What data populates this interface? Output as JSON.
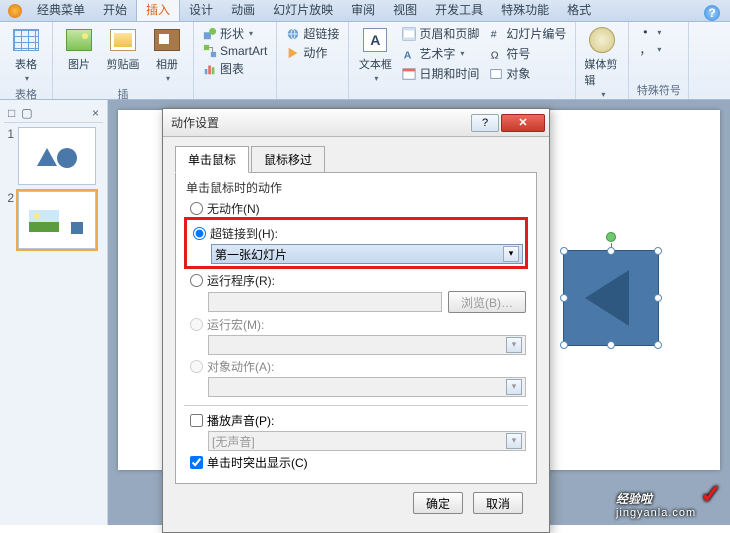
{
  "tabs": {
    "classic": "经典菜单",
    "home": "开始",
    "insert": "插入",
    "design": "设计",
    "anim": "动画",
    "slideshow": "幻灯片放映",
    "review": "审阅",
    "view": "视图",
    "dev": "开发工具",
    "special": "特殊功能",
    "format": "格式"
  },
  "ribbon": {
    "table": "表格",
    "picture": "图片",
    "clipart": "剪贴画",
    "album": "相册",
    "shapes": "形状",
    "smartart": "SmartArt",
    "chart": "图表",
    "hyperlink": "超链接",
    "action": "动作",
    "textbox": "文本框",
    "headerfooter": "页眉和页脚",
    "wordart": "艺术字",
    "datetime": "日期和时间",
    "slidenum": "幻灯片编号",
    "symbol": "符号",
    "object": "对象",
    "media": "媒体剪辑",
    "group_table": "表格",
    "group_illus": "插",
    "group_special": "特殊符号"
  },
  "sidepanel": {
    "tab1": "□",
    "tab2": "▢",
    "close": "×",
    "slide1": "1",
    "slide2": "2"
  },
  "dialog": {
    "title": "动作设置",
    "help": "?",
    "close": "✕",
    "tab_click": "单击鼠标",
    "tab_hover": "鼠标移过",
    "section": "单击鼠标时的动作",
    "opt_none": "无动作(N)",
    "opt_hyperlink": "超链接到(H):",
    "hyperlink_value": "第一张幻灯片",
    "opt_run": "运行程序(R):",
    "browse": "浏览(B)…",
    "opt_macro": "运行宏(M):",
    "opt_object": "对象动作(A):",
    "chk_sound": "播放声音(P):",
    "sound_value": "[无声音]",
    "chk_highlight": "单击时突出显示(C)",
    "ok": "确定",
    "cancel": "取消"
  },
  "watermark": {
    "main": "经验啦",
    "sub": "jingyanla.com"
  }
}
